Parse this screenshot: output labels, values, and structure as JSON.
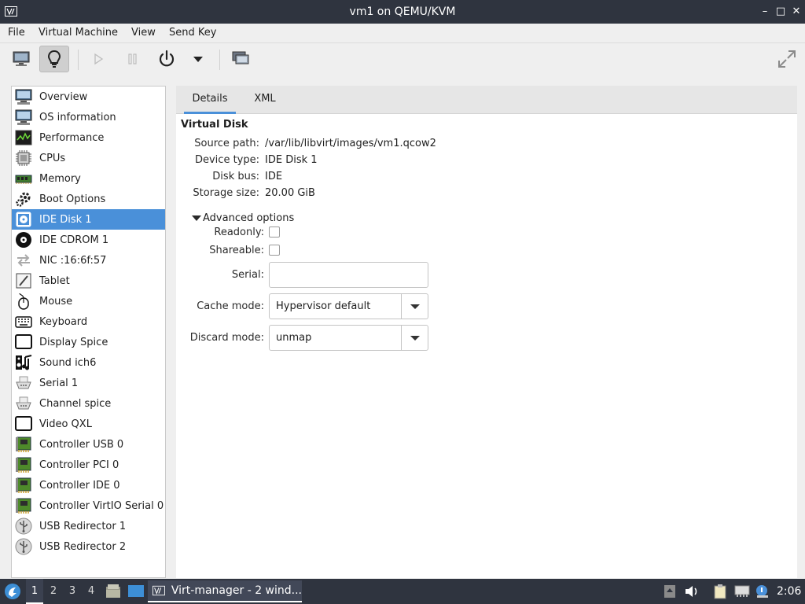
{
  "window": {
    "title": "vm1 on QEMU/KVM"
  },
  "window_controls": {
    "minimize": "–",
    "maximize": "□",
    "close": "✕"
  },
  "menu": [
    "File",
    "Virtual Machine",
    "View",
    "Send Key"
  ],
  "toolbar": {
    "buttons": [
      "monitor-icon",
      "lightbulb-icon",
      "play-icon",
      "pause-icon",
      "power-icon",
      "dropdown-icon",
      "snapshots-icon",
      "fullscreen-icon"
    ],
    "active": "lightbulb-icon"
  },
  "sidebar": {
    "selected_index": 6,
    "items": [
      {
        "label": "Overview",
        "icon": "computer-icon"
      },
      {
        "label": "OS information",
        "icon": "computer-icon"
      },
      {
        "label": "Performance",
        "icon": "performance-icon"
      },
      {
        "label": "CPUs",
        "icon": "cpu-icon"
      },
      {
        "label": "Memory",
        "icon": "memory-icon"
      },
      {
        "label": "Boot Options",
        "icon": "gear-icon"
      },
      {
        "label": "IDE Disk 1",
        "icon": "disk-icon"
      },
      {
        "label": "IDE CDROM 1",
        "icon": "cdrom-icon"
      },
      {
        "label": "NIC :16:6f:57",
        "icon": "network-icon"
      },
      {
        "label": "Tablet",
        "icon": "tablet-icon"
      },
      {
        "label": "Mouse",
        "icon": "mouse-icon"
      },
      {
        "label": "Keyboard",
        "icon": "keyboard-icon"
      },
      {
        "label": "Display Spice",
        "icon": "display-icon"
      },
      {
        "label": "Sound ich6",
        "icon": "sound-icon"
      },
      {
        "label": "Serial 1",
        "icon": "serial-icon"
      },
      {
        "label": "Channel spice",
        "icon": "serial-icon"
      },
      {
        "label": "Video QXL",
        "icon": "display-icon"
      },
      {
        "label": "Controller USB 0",
        "icon": "controller-icon"
      },
      {
        "label": "Controller PCI 0",
        "icon": "controller-icon"
      },
      {
        "label": "Controller IDE 0",
        "icon": "controller-icon"
      },
      {
        "label": "Controller VirtIO Serial 0",
        "icon": "controller-icon"
      },
      {
        "label": "USB Redirector 1",
        "icon": "usb-icon"
      },
      {
        "label": "USB Redirector 2",
        "icon": "usb-icon"
      }
    ]
  },
  "tabs": [
    {
      "label": "Details",
      "active": true
    },
    {
      "label": "XML",
      "active": false
    }
  ],
  "details": {
    "section_title": "Virtual Disk",
    "properties": [
      {
        "label": "Source path:",
        "value": "/var/lib/libvirt/images/vm1.qcow2"
      },
      {
        "label": "Device type:",
        "value": "IDE Disk 1"
      },
      {
        "label": "Disk bus:",
        "value": "IDE"
      },
      {
        "label": "Storage size:",
        "value": "20.00 GiB"
      }
    ],
    "advanced": {
      "label": "Advanced options",
      "readonly_label": "Readonly:",
      "readonly_checked": false,
      "shareable_label": "Shareable:",
      "shareable_checked": false,
      "serial_label": "Serial:",
      "serial_value": "",
      "cache_label": "Cache mode:",
      "cache_value": "Hypervisor default",
      "discard_label": "Discard mode:",
      "discard_value": "unmap"
    }
  },
  "taskbar": {
    "workspaces": [
      "1",
      "2",
      "3",
      "4"
    ],
    "active_workspace": "1",
    "task_label": "Virt-manager - 2 wind...",
    "clock": "2:06"
  },
  "colors": {
    "selection": "#4a90d9",
    "titlebar": "#2f343f"
  }
}
